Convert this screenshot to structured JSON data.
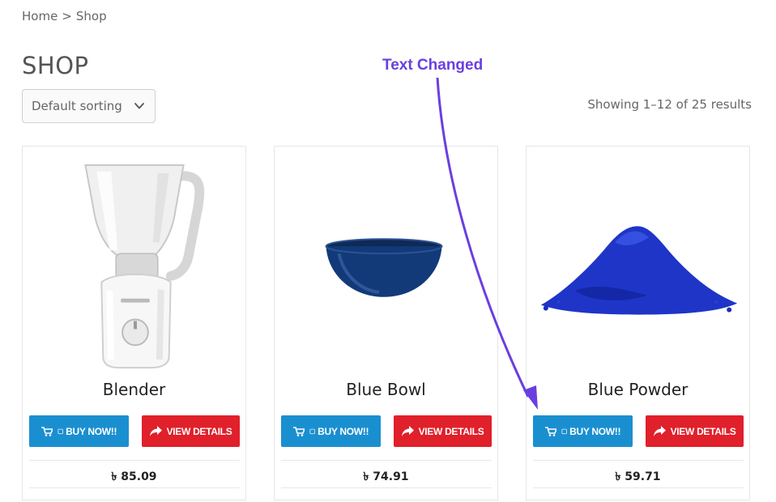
{
  "breadcrumb": {
    "home": "Home",
    "separator": ">",
    "current": "Shop"
  },
  "page": {
    "title": "SHOP"
  },
  "sorting": {
    "selected": "Default sorting"
  },
  "results": {
    "text": "Showing 1–12 of 25 results"
  },
  "annotation": {
    "text": "Text Changed",
    "color": "#6a3fe0"
  },
  "colors": {
    "buy_button": "#1a8fd0",
    "view_button": "#e0202a"
  },
  "products": [
    {
      "name": "Blender",
      "buy_label": "BUY NOW!!",
      "view_label": "VIEW DETAILS",
      "price": "৳ 85.09",
      "icon": "blender-image"
    },
    {
      "name": "Blue Bowl",
      "buy_label": "BUY NOW!!",
      "view_label": "VIEW DETAILS",
      "price": "৳ 74.91",
      "icon": "bowl-image"
    },
    {
      "name": "Blue Powder",
      "buy_label": "BUY NOW!!",
      "view_label": "VIEW DETAILS",
      "price": "৳ 59.71",
      "icon": "powder-image"
    }
  ]
}
